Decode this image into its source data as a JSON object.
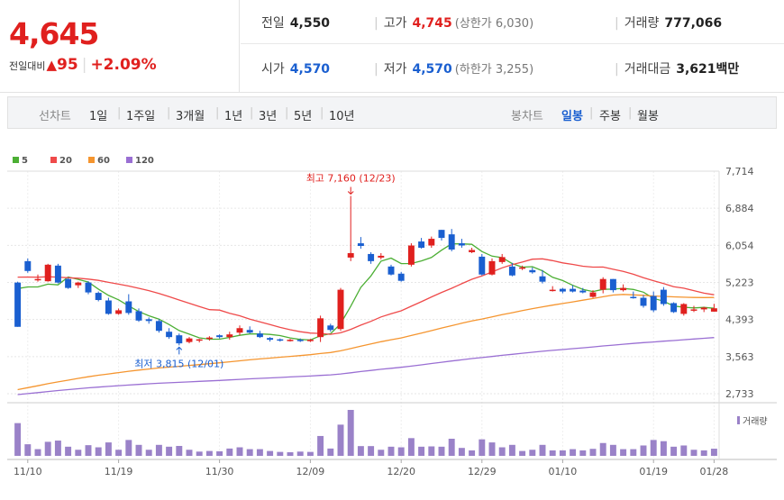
{
  "price": "4,645",
  "change": {
    "label": "전일대비",
    "arrow": "▲",
    "amount": "95",
    "separator": "|",
    "percent": "+2.09%"
  },
  "stats": {
    "prev_close": {
      "label": "전일",
      "value": "4,550"
    },
    "high": {
      "label": "고가",
      "value": "4,745",
      "sub": "(상한가 6,030)"
    },
    "volume": {
      "label": "거래량",
      "value": "777,066"
    },
    "open": {
      "label": "시가",
      "value": "4,570"
    },
    "low": {
      "label": "저가",
      "value": "4,570",
      "sub": "(하한가 3,255)"
    },
    "trade_value": {
      "label": "거래대금",
      "value": "3,621",
      "unit": "백만"
    }
  },
  "line_chart_tabs": {
    "label": "선차트",
    "items": [
      "1일",
      "1주일",
      "3개월",
      "1년",
      "3년",
      "5년",
      "10년"
    ]
  },
  "candle_chart_tabs": {
    "label": "봉차트",
    "items": [
      "일봉",
      "주봉",
      "월봉"
    ],
    "active": "일봉"
  },
  "chart_data": {
    "type": "candlestick",
    "legend": [
      {
        "name": "5",
        "color": "#4caf34"
      },
      {
        "name": "20",
        "color": "#ef4a4a"
      },
      {
        "name": "60",
        "color": "#f5952f"
      },
      {
        "name": "120",
        "color": "#9a6fd3"
      }
    ],
    "y_ticks": [
      "7,714",
      "6,884",
      "6,054",
      "5,223",
      "4,393",
      "3,563",
      "2,733"
    ],
    "ylim": [
      2733,
      7714
    ],
    "x_ticks": [
      "11/10",
      "11/19",
      "11/30",
      "12/09",
      "12/20",
      "12/29",
      "01/10",
      "01/19",
      "01/28"
    ],
    "annotations": [
      {
        "text": "최고 7,160 (12/23)",
        "value": 7160,
        "type": "high"
      },
      {
        "text": "최저 3,815 (12/01)",
        "value": 3815,
        "type": "low"
      }
    ],
    "volume_legend": "거래량",
    "up_color": "#e0201e",
    "down_color": "#1a5fd0",
    "candles": [
      [
        5220,
        5240,
        4230,
        4230
      ],
      [
        5700,
        5760,
        5440,
        5480
      ],
      [
        5300,
        5400,
        5240,
        5300
      ],
      [
        5250,
        5640,
        5240,
        5620
      ],
      [
        5600,
        5640,
        5200,
        5220
      ],
      [
        5300,
        5320,
        5080,
        5100
      ],
      [
        5160,
        5240,
        5100,
        5220
      ],
      [
        5220,
        5250,
        4960,
        5000
      ],
      [
        4990,
        5020,
        4800,
        4830
      ],
      [
        4820,
        4880,
        4500,
        4520
      ],
      [
        4520,
        4640,
        4500,
        4600
      ],
      [
        4800,
        4960,
        4500,
        4540
      ],
      [
        4580,
        4640,
        4340,
        4370
      ],
      [
        4400,
        4440,
        4300,
        4360
      ],
      [
        4360,
        4400,
        4100,
        4140
      ],
      [
        4120,
        4200,
        3960,
        4000
      ],
      [
        4040,
        4080,
        3815,
        3860
      ],
      [
        3890,
        4000,
        3860,
        3970
      ],
      [
        3920,
        3960,
        3880,
        3950
      ],
      [
        3960,
        4020,
        3920,
        3990
      ],
      [
        4040,
        4060,
        3970,
        4000
      ],
      [
        4000,
        4120,
        3940,
        4060
      ],
      [
        4100,
        4260,
        4040,
        4200
      ],
      [
        4160,
        4240,
        4080,
        4100
      ],
      [
        4080,
        4140,
        3980,
        4000
      ],
      [
        3980,
        4000,
        3900,
        3940
      ],
      [
        3950,
        3970,
        3900,
        3930
      ],
      [
        3930,
        3960,
        3900,
        3940
      ],
      [
        3940,
        3970,
        3890,
        3920
      ],
      [
        3930,
        3960,
        3890,
        3940
      ],
      [
        4000,
        4480,
        3890,
        4420
      ],
      [
        4260,
        4300,
        4120,
        4160
      ],
      [
        4180,
        5100,
        4140,
        5060
      ],
      [
        5780,
        7160,
        5700,
        5880
      ],
      [
        6100,
        6240,
        5980,
        6040
      ],
      [
        5860,
        5900,
        5640,
        5700
      ],
      [
        5780,
        5880,
        5740,
        5820
      ],
      [
        5580,
        5620,
        5380,
        5400
      ],
      [
        5420,
        5460,
        5240,
        5260
      ],
      [
        5620,
        6100,
        5580,
        6050
      ],
      [
        6140,
        6220,
        5980,
        6000
      ],
      [
        6050,
        6250,
        6000,
        6200
      ],
      [
        6400,
        6400,
        6160,
        6220
      ],
      [
        6300,
        6420,
        5920,
        5960
      ],
      [
        6100,
        6200,
        6000,
        6050
      ],
      [
        5900,
        6000,
        5880,
        5950
      ],
      [
        5800,
        5860,
        5380,
        5400
      ],
      [
        5400,
        5760,
        5380,
        5700
      ],
      [
        5680,
        5860,
        5640,
        5790
      ],
      [
        5580,
        5660,
        5360,
        5380
      ],
      [
        5550,
        5600,
        5500,
        5560
      ],
      [
        5500,
        5560,
        5420,
        5450
      ],
      [
        5360,
        5500,
        5200,
        5240
      ],
      [
        5060,
        5140,
        5020,
        5060
      ],
      [
        5080,
        5100,
        4980,
        5020
      ],
      [
        5080,
        5160,
        5000,
        5020
      ],
      [
        5040,
        5100,
        4980,
        5000
      ],
      [
        4900,
        5050,
        4880,
        5000
      ],
      [
        5060,
        5340,
        4980,
        5300
      ],
      [
        5300,
        5300,
        5000,
        5050
      ],
      [
        5050,
        5180,
        5020,
        5100
      ],
      [
        4900,
        5020,
        4860,
        4880
      ],
      [
        4880,
        4940,
        4660,
        4700
      ],
      [
        4920,
        5020,
        4560,
        4600
      ],
      [
        5060,
        5120,
        4700,
        4740
      ],
      [
        4760,
        4780,
        4540,
        4560
      ],
      [
        4520,
        4760,
        4480,
        4740
      ],
      [
        4600,
        4700,
        4560,
        4620
      ],
      [
        4620,
        4680,
        4560,
        4660
      ],
      [
        4570,
        4745,
        4570,
        4645
      ]
    ]
  }
}
